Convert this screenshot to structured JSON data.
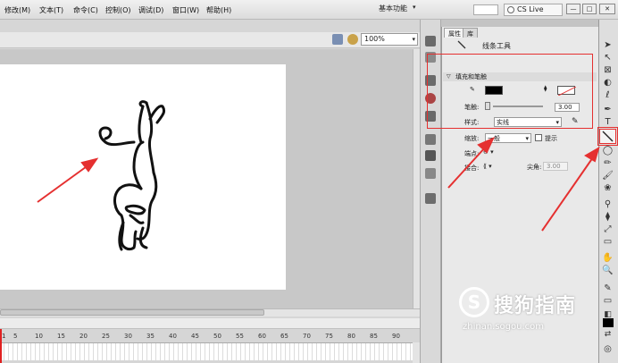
{
  "menu": {
    "items": [
      "修改(M)",
      "文本(T)",
      "命令(C)",
      "控制(O)",
      "调试(D)",
      "窗口(W)",
      "帮助(H)"
    ],
    "workspace": "基本功能",
    "cs_live": "CS Live"
  },
  "window_buttons": {
    "min": "—",
    "max": "□",
    "close": "✕"
  },
  "edit_bar": {
    "zoom": "100%"
  },
  "timeline": {
    "frame_numbers": [
      "1",
      "5",
      "10",
      "15",
      "20",
      "25",
      "30",
      "35",
      "40",
      "45",
      "50",
      "55",
      "60",
      "65",
      "70",
      "75",
      "80",
      "85",
      "90"
    ]
  },
  "panel": {
    "tabs": [
      "属性",
      "库"
    ],
    "tool_name": "线条工具",
    "section": "填充和笔触",
    "stroke_label": "笔触:",
    "stroke_value": "3.00",
    "style_label": "样式:",
    "style_value": "实线",
    "scale_label": "缩放:",
    "scale_value": "一般",
    "hint_label": "提示",
    "cap_label": "端点:",
    "join_label": "接合:",
    "miter_label": "尖角:",
    "miter_value": "3.00",
    "stroke_color": "#000000",
    "fill_color": "#ffffff"
  },
  "watermark": {
    "symbol": "S",
    "text": "搜狗指南",
    "url": "zhinan.sogou.com"
  },
  "colors": {
    "annotation": "#e53030"
  }
}
